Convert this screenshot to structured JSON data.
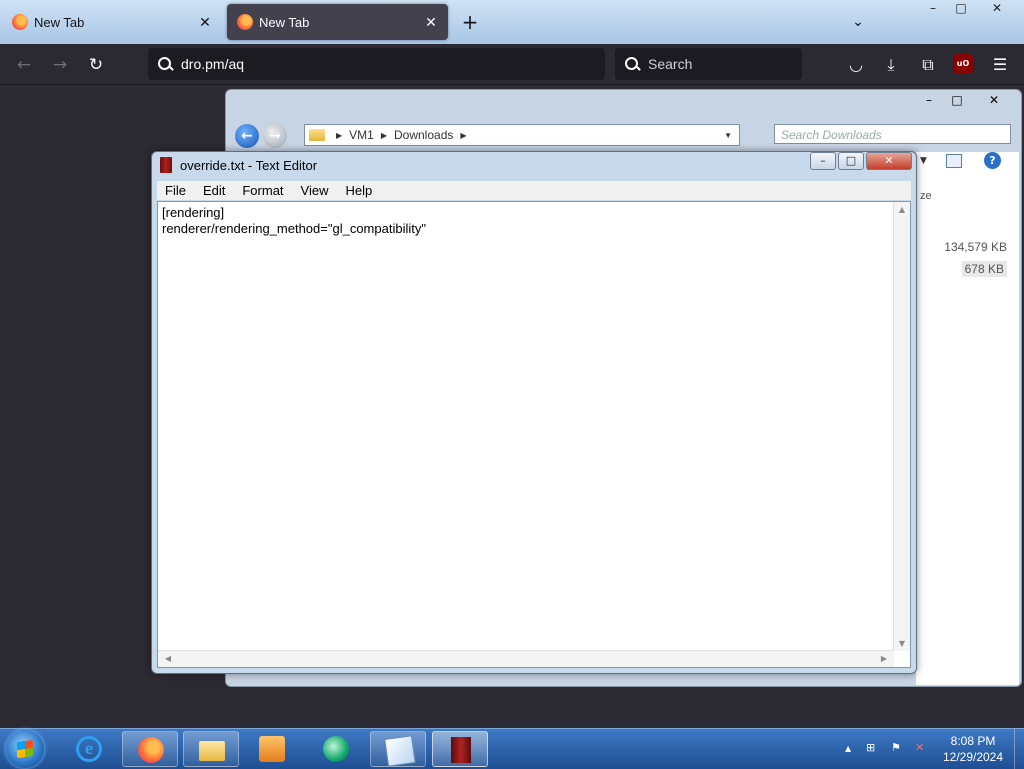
{
  "browser": {
    "tabs": [
      {
        "label": "New Tab",
        "active": false
      },
      {
        "label": "New Tab",
        "active": true
      }
    ],
    "url": "dro.pm/aq",
    "search_placeholder": "Search",
    "ublock_label": "uO",
    "accent_color": "#42414d"
  },
  "explorer": {
    "breadcrumbs": [
      "VM1",
      "Downloads"
    ],
    "search_placeholder": "Search Downloads",
    "sizes": [
      "134,579 KB",
      "678 KB"
    ],
    "column_fragment": "ze"
  },
  "editor": {
    "title": "override.txt - Text Editor",
    "menu": [
      "File",
      "Edit",
      "Format",
      "View",
      "Help"
    ],
    "lines": [
      "[rendering]",
      "renderer/rendering_method=\"gl_compatibility\""
    ]
  },
  "taskbar": {
    "apps": [
      "internet-explorer-icon",
      "firefox-icon",
      "file-explorer-icon",
      "media-player-icon",
      "green-app-icon",
      "notepad-icon",
      "text-editor-icon"
    ],
    "time": "8:08 PM",
    "date": "12/29/2024"
  },
  "icons": {
    "tab_close": "✕",
    "new_tab": "+",
    "tab_list": "⌄",
    "back": "←",
    "forward": "→",
    "reload": "↻",
    "pocket": "◡",
    "download": "⤓",
    "extensions": "⧉",
    "menu": "☰",
    "minimize": "–",
    "maximize": "□",
    "close": "✕",
    "arrow_back": "←",
    "arrow_fwd": "→",
    "caret_right": "▶",
    "caret_down": "▼",
    "up": "▲",
    "down": "▼",
    "left": "◀",
    "right": "▶",
    "help": "?",
    "tray_up": "▲",
    "network": "⊞",
    "flag": "⚑",
    "speaker_mute": "✕"
  }
}
